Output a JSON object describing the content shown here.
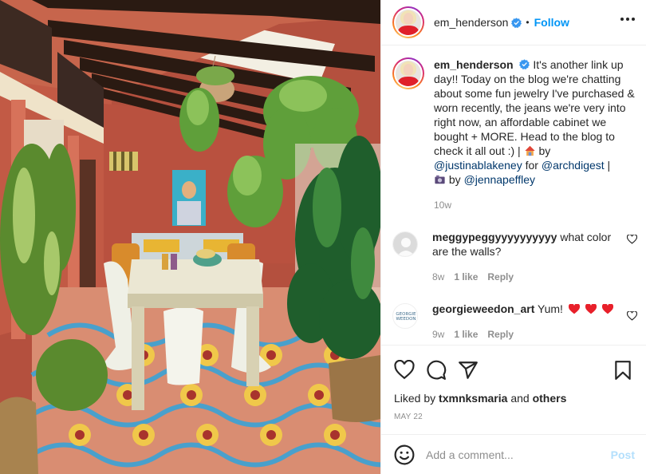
{
  "post": {
    "author": {
      "username": "em_henderson",
      "verified": true,
      "follow_label": "Follow",
      "more_icon": "more-options-icon"
    },
    "image": {
      "description": "Terracotta-walled dining room with dark wood ceiling beams, hanging ferns, white table, white chairs and patterned cement floor tiles",
      "colors": {
        "wall": "#b9513f",
        "beam": "#2a1a12",
        "floor_blue": "#3aa3d6",
        "table": "#e8e4cf"
      }
    },
    "caption": {
      "username": "em_henderson",
      "text_1": "It's another link up day!! Today on the blog we're chatting about some fun jewelry I've purchased & worn recently, the jeans we're very into right now, an affordable cabinet we bought + MORE. Head to the blog to check it all out :) | ",
      "emoji_house": "house-emoji",
      "text_2": " by ",
      "mention_1": "@justinablakeney",
      "text_3": " for ",
      "mention_2": "@archdigest",
      "text_4": " |",
      "emoji_camera": "camera-emoji",
      "text_5": " by ",
      "mention_3": "@jennapeffley",
      "age": "10w"
    },
    "comments": [
      {
        "username": "meggypeggyyyyyyyyyy",
        "text": "what color are the walls?",
        "age": "8w",
        "likes": "1 like",
        "reply_label": "Reply",
        "avatar": "default-avatar"
      },
      {
        "username": "georgieweedon_art",
        "text": "Yum!",
        "emoji": [
          "red-heart",
          "red-heart",
          "red-heart"
        ],
        "age": "9w",
        "likes": "1 like",
        "reply_label": "Reply",
        "avatar_text": "GEORGIE WEEDON"
      }
    ],
    "actions": {
      "icons": [
        "like-icon",
        "comment-icon",
        "share-icon",
        "save-icon"
      ]
    },
    "liked_by": {
      "prefix": "Liked by ",
      "user": "txmnksmaria",
      "middle": " and ",
      "others": "others"
    },
    "date": "MAY 22",
    "add_comment": {
      "placeholder": "Add a comment...",
      "value": "",
      "post_label": "Post"
    }
  },
  "colors": {
    "accent": "#0095f6",
    "link": "#00376b",
    "muted": "#8e8e8e",
    "post_disabled": "#b3dffc",
    "heart": "#ed4956"
  }
}
